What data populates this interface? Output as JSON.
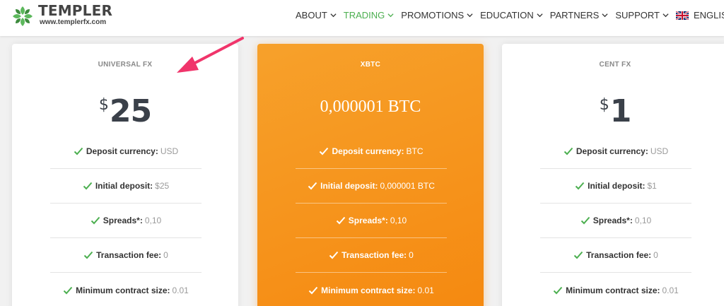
{
  "logo": {
    "name": "TEMPLER",
    "url": "www.templerfx.com"
  },
  "nav": {
    "items": [
      {
        "label": "ABOUT",
        "active": false
      },
      {
        "label": "TRADING",
        "active": true
      },
      {
        "label": "PROMOTIONS",
        "active": false
      },
      {
        "label": "EDUCATION",
        "active": false
      },
      {
        "label": "PARTNERS",
        "active": false
      },
      {
        "label": "SUPPORT",
        "active": false
      }
    ],
    "language": "ENGLISH"
  },
  "cards": [
    {
      "name": "UNIVERSAL FX",
      "currency_symbol": "$",
      "amount": "25",
      "features": [
        {
          "label": "Deposit currency:",
          "value": "USD"
        },
        {
          "label": "Initial deposit:",
          "value": "$25"
        },
        {
          "label": "Spreads*:",
          "value": "0,10"
        },
        {
          "label": "Transaction fee:",
          "value": "0"
        },
        {
          "label": "Minimum contract size:",
          "value": "0.01"
        }
      ]
    },
    {
      "name": "XBTC",
      "price_text": "0,000001 BTC",
      "features": [
        {
          "label": "Deposit currency:",
          "value": "BTC"
        },
        {
          "label": "Initial deposit:",
          "value": "0,000001 BTC"
        },
        {
          "label": "Spreads*:",
          "value": "0,10"
        },
        {
          "label": "Transaction fee:",
          "value": "0"
        },
        {
          "label": "Minimum contract size:",
          "value": "0.01"
        }
      ]
    },
    {
      "name": "CENT FX",
      "currency_symbol": "$",
      "amount": "1",
      "features": [
        {
          "label": "Deposit currency:",
          "value": "USD"
        },
        {
          "label": "Initial deposit:",
          "value": "$1"
        },
        {
          "label": "Spreads*:",
          "value": "0,10"
        },
        {
          "label": "Transaction fee:",
          "value": "0"
        },
        {
          "label": "Minimum contract size:",
          "value": "0.01"
        }
      ]
    }
  ],
  "colors": {
    "brand_green": "#4caf50",
    "featured_orange": "#f58910",
    "annotation_arrow": "#f0356b"
  },
  "icons": [
    "templer-logo-icon",
    "chevron-down-icon",
    "uk-flag-icon",
    "check-icon",
    "annotation-arrow-icon"
  ]
}
